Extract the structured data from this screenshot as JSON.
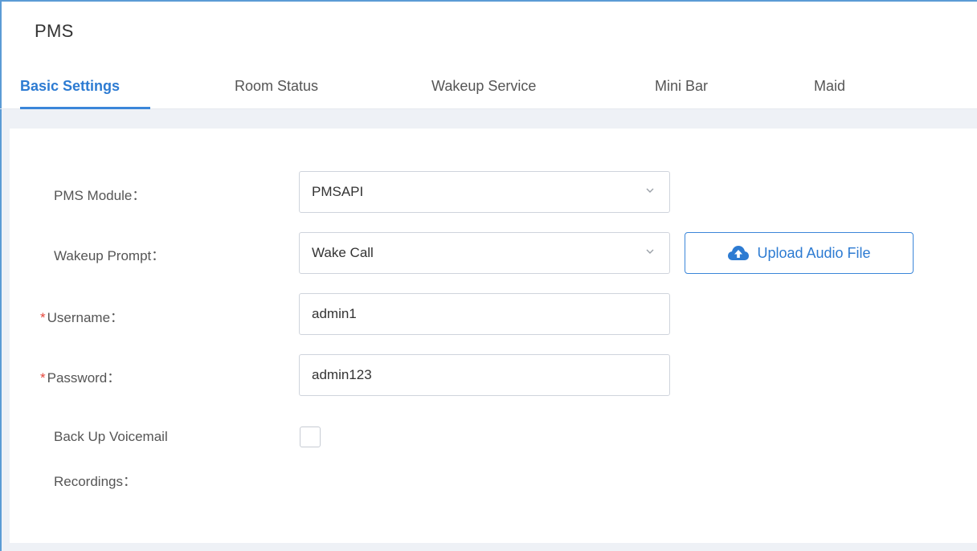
{
  "header": {
    "title": "PMS"
  },
  "tabs": [
    {
      "label": "Basic Settings",
      "active": true
    },
    {
      "label": "Room Status",
      "active": false
    },
    {
      "label": "Wakeup Service",
      "active": false
    },
    {
      "label": "Mini Bar",
      "active": false
    },
    {
      "label": "Maid",
      "active": false
    }
  ],
  "form": {
    "pms_module": {
      "label": "PMS Module：",
      "value": "PMSAPI"
    },
    "wakeup_prompt": {
      "label": "Wakeup Prompt：",
      "value": "Wake Call",
      "upload_button_label": "Upload Audio File"
    },
    "username": {
      "required_mark": "*",
      "label": "Username：",
      "value": "admin1"
    },
    "password": {
      "required_mark": "*",
      "label": "Password：",
      "value": "admin123"
    },
    "backup_voicemail": {
      "label_line1": "Back Up Voicemail",
      "label_line2": "Recordings：",
      "checked": false
    }
  },
  "colors": {
    "accent": "#2d7bd2",
    "required": "#e5463b",
    "content_background": "#eef1f6"
  },
  "icons": {
    "dropdown": "chevron-down-icon",
    "upload": "cloud-upload-icon"
  }
}
